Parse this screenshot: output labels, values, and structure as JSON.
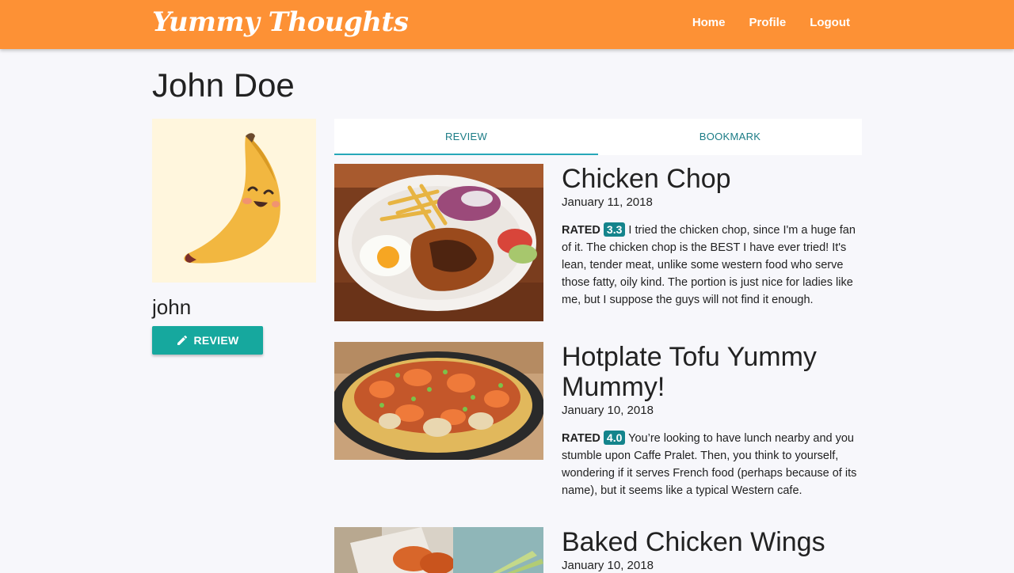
{
  "app": {
    "brand": "Yummy Thoughts",
    "nav": [
      "Home",
      "Profile",
      "Logout"
    ]
  },
  "profile": {
    "title": "John Doe",
    "username": "john",
    "review_button": "REVIEW",
    "avatar_icon": "banana-avatar"
  },
  "tabs": [
    "REVIEW",
    "BOOKMARK"
  ],
  "reviews": [
    {
      "title": "Chicken Chop",
      "date": "January 11, 2018",
      "rated_label": "RATED",
      "rating": "3.3",
      "text": "I tried the chicken chop, since I'm a huge fan of it. The chicken chop is the BEST I have ever tried! It's lean, tender meat, unlike some western food who serve those fatty, oily kind. The portion is just nice for ladies like me, but I suppose the guys will not find it enough."
    },
    {
      "title": "Hotplate Tofu Yummy Mummy!",
      "date": "January 10, 2018",
      "rated_label": "RATED",
      "rating": "4.0",
      "text": "You’re looking to have lunch nearby and you stumble upon Caffe Pralet. Then, you think to yourself, wondering if it serves French food (perhaps because of its name), but it seems like a typical Western cafe."
    },
    {
      "title": "Baked Chicken Wings",
      "date": "January 10, 2018",
      "rated_label": "",
      "rating": "",
      "text": ""
    }
  ],
  "colors": {
    "navbar": "#fd9135",
    "accent": "#16a89e",
    "badge": "#14848c",
    "tab_text": "#1b7c86"
  }
}
